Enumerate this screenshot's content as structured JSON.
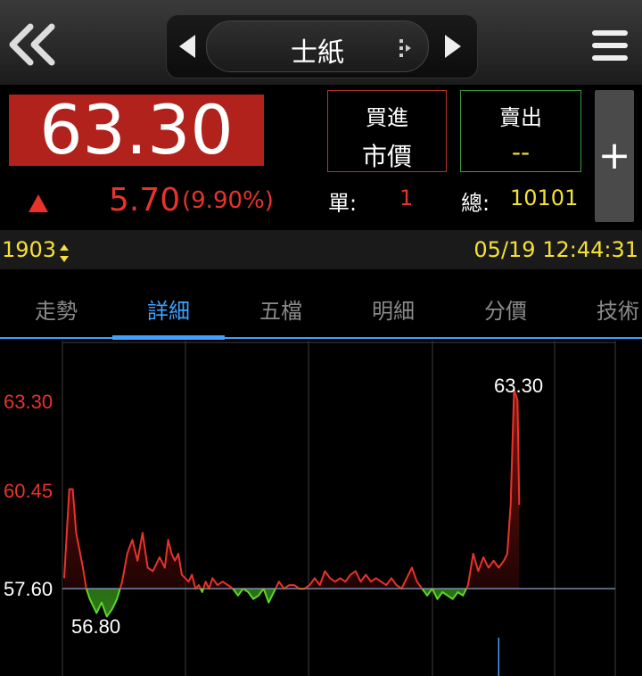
{
  "header": {
    "title": "士紙",
    "back_icon": "double-chevron-left-icon",
    "menu_icon": "hamburger-menu-icon"
  },
  "quote": {
    "price": "63.30",
    "change": "5.70",
    "change_pct": "(9.90%)",
    "direction": "up"
  },
  "order": {
    "buy_label": "買進",
    "buy_value": "市價",
    "sell_label": "賣出",
    "sell_value": "--",
    "unit_label": "單:",
    "unit_value": "1",
    "total_label": "總:",
    "total_value": "10101",
    "plus_label": "+"
  },
  "info": {
    "code": "1903",
    "datetime": "05/19 12:44:31"
  },
  "tabs": [
    {
      "label": "走勢",
      "active": false
    },
    {
      "label": "詳細",
      "active": true
    },
    {
      "label": "五檔",
      "active": false
    },
    {
      "label": "明細",
      "active": false
    },
    {
      "label": "分價",
      "active": false
    },
    {
      "label": "技術",
      "active": false
    }
  ],
  "colors": {
    "up": "#e8332a",
    "down": "#5ed62e",
    "accent": "#3fa0ff",
    "highlight": "#f5e033"
  },
  "chart_data": {
    "type": "line",
    "y_ticks": [
      "63.30",
      "60.45",
      "57.60"
    ],
    "reference": 57.6,
    "ylim": [
      56.8,
      63.3
    ],
    "xlim": [
      0,
      270
    ],
    "annotations": {
      "high": "63.30",
      "low": "56.80"
    },
    "x": [
      0,
      2,
      3,
      5,
      7,
      9,
      11,
      13,
      15,
      17,
      19,
      22,
      25,
      28,
      31,
      34,
      37,
      40,
      43,
      46,
      49,
      52,
      55,
      56,
      59,
      61,
      63,
      65,
      67,
      69,
      71,
      73,
      75,
      77,
      79,
      81,
      83,
      85,
      87,
      90,
      93,
      96,
      99,
      102,
      105,
      108,
      111,
      114,
      117,
      120,
      123,
      126,
      129,
      132,
      135,
      138,
      141,
      144,
      147,
      150,
      153,
      156,
      159,
      162,
      165,
      168,
      171,
      174,
      177,
      180,
      183,
      186,
      189,
      192,
      195,
      198,
      201,
      204,
      207,
      210,
      213,
      216,
      219,
      222,
      225,
      228,
      231,
      234,
      237,
      240,
      243,
      246,
      249,
      252,
      255,
      258,
      260,
      262,
      264,
      266,
      267
    ],
    "y": [
      57.9,
      59.6,
      60.45,
      60.45,
      59.2,
      58.7,
      58.2,
      57.6,
      57.3,
      57.1,
      56.9,
      57.2,
      56.8,
      57.0,
      57.3,
      57.8,
      58.6,
      59.0,
      58.4,
      59.2,
      58.2,
      58.1,
      58.4,
      58.5,
      58.2,
      59.0,
      58.6,
      58.4,
      58.6,
      58.0,
      57.9,
      57.8,
      58.0,
      57.6,
      57.7,
      57.5,
      57.8,
      57.6,
      57.9,
      57.7,
      57.8,
      57.7,
      57.6,
      57.4,
      57.6,
      57.5,
      57.3,
      57.4,
      57.6,
      57.2,
      57.5,
      57.8,
      57.6,
      57.7,
      57.7,
      57.6,
      57.6,
      57.7,
      57.9,
      57.7,
      58.1,
      57.9,
      57.8,
      57.9,
      57.8,
      58.0,
      58.1,
      57.8,
      58.0,
      57.8,
      57.9,
      57.8,
      57.7,
      57.9,
      57.7,
      57.6,
      57.9,
      58.2,
      57.8,
      57.6,
      57.4,
      57.6,
      57.3,
      57.5,
      57.4,
      57.3,
      57.5,
      57.4,
      57.7,
      58.6,
      58.1,
      58.5,
      58.2,
      58.4,
      58.2,
      58.4,
      58.6,
      60.0,
      63.3,
      63.0,
      60.0
    ],
    "volume_x": [
      255
    ],
    "grid": true
  }
}
